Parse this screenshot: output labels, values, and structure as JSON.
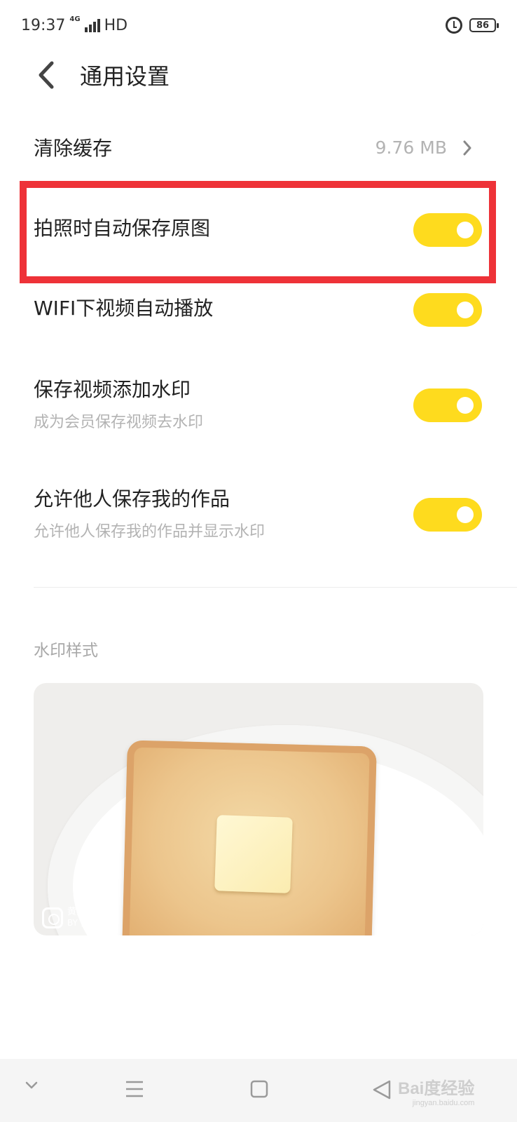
{
  "status_bar": {
    "time": "19:37",
    "network": "4G",
    "hd": "HD",
    "battery": "86",
    "icons": [
      "signal-icon",
      "alarm-icon",
      "battery-icon"
    ]
  },
  "header": {
    "back_icon": "chevron-left-icon",
    "title": "通用设置"
  },
  "settings": {
    "clear_cache": {
      "label": "清除缓存",
      "value": "9.76 MB"
    },
    "auto_save_original": {
      "label": "拍照时自动保存原图",
      "enabled": true
    },
    "wifi_autoplay": {
      "label": "WIFI下视频自动播放",
      "enabled": true
    },
    "video_watermark": {
      "label": "保存视频添加水印",
      "subtitle": "成为会员保存视频去水印",
      "enabled": true
    },
    "allow_save": {
      "label": "允许他人保存我的作品",
      "subtitle": "允许他人保存我的作品并显示水印",
      "enabled": true
    }
  },
  "watermark_section": {
    "label": "水印样式",
    "preview_brand": "黄油相机",
    "preview_name": "BY 你的名字"
  },
  "nav_bar": {
    "icons": [
      "chevron-down-icon",
      "menu-icon",
      "home-square-icon",
      "back-triangle-icon"
    ],
    "watermark": "Bai度经验",
    "watermark_sub": "jingyan.baidu.com"
  },
  "colors": {
    "toggle_on": "#fedb1e",
    "highlight": "#ee3238",
    "subtext": "#b3b3b3"
  }
}
